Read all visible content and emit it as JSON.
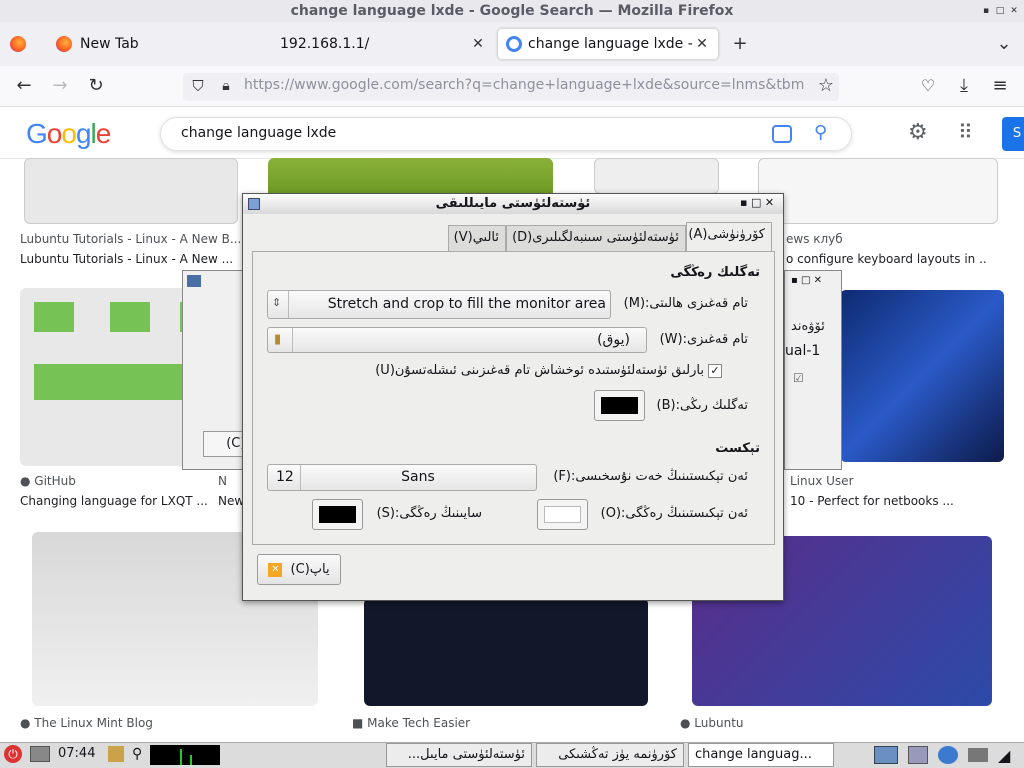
{
  "window": {
    "title": "change language lxde - Google Search — Mozilla Firefox"
  },
  "tabs": [
    {
      "label": "New Tab"
    },
    {
      "label": "192.168.1.1/"
    },
    {
      "label": "change language lxde - G"
    }
  ],
  "nav": {
    "url": "https://www.google.com/search?q=change+language+lxde&source=lnms&tbm"
  },
  "google": {
    "query": "change language lxde",
    "apps_label": "S"
  },
  "results": [
    {
      "source": "Lubuntu Tutorials - Linux - A New B...",
      "title": "Lubuntu Tutorials - Linux - A New ..."
    },
    {
      "source": "ews клуб",
      "title": "o configure keyboard layouts in ..."
    },
    {
      "source": "GitHub",
      "title": "Changing language for LXQT ..."
    },
    {
      "source": "N",
      "title": "New"
    },
    {
      "source": "Linux User",
      "title": "10 - Perfect for netbooks ..."
    },
    {
      "source": "The Linux Mint Blog",
      "title": ""
    },
    {
      "source": "Make Tech Easier",
      "title": ""
    },
    {
      "source": "Lubuntu",
      "title": ""
    }
  ],
  "back_window": {
    "text1": "ئۆۋەند",
    "text2": "ual-1",
    "button": "ۆر(C)"
  },
  "dialog": {
    "title": "ئۈستەلئۈستى مايىللىقى",
    "tabs": [
      "كۆرۈنۈشى(A)",
      "ئۈستەلئۈستى سىنبەلگىلىرى(D)",
      "ئالىي(V)"
    ],
    "section_bg": "تەگلىك رەڭگى",
    "wallpaper_mode_label": "تام قەغىزى ھالىتى:(M)",
    "wallpaper_mode_value": "Stretch and crop to fill the monitor area",
    "wallpaper_label": "تام قەغىزى:(W)",
    "wallpaper_value": "(يوق)",
    "all_desktops_label": "بارلىق ئۈستەلئۈستىدە ئوخشاش تام قەغىزىنى ئىشلەتسۇن(U)",
    "bg_color_label": "تەگلىك رىڭى:(B)",
    "section_text": "تېكست",
    "font_label": "ئەن تېكىستىنىڭ خەت نۇسخىسى:(F)",
    "font_name": "Sans",
    "font_size": "12",
    "text_color_label": "ئەن تېكىستىنىڭ رەڭگى:(O)",
    "shadow_color_label": "سايىنىڭ رەڭگى:(S)",
    "close_label": "ياپ(C)",
    "bg_color": "#000000",
    "text_color": "#ffffff",
    "shadow_color": "#000000"
  },
  "taskbar": {
    "time": "07:44",
    "tasks": [
      "ئۈستەلئۈستى مايىل...",
      "كۆرۈنمە يۈز تەڭشىكى",
      "change languag..."
    ]
  }
}
